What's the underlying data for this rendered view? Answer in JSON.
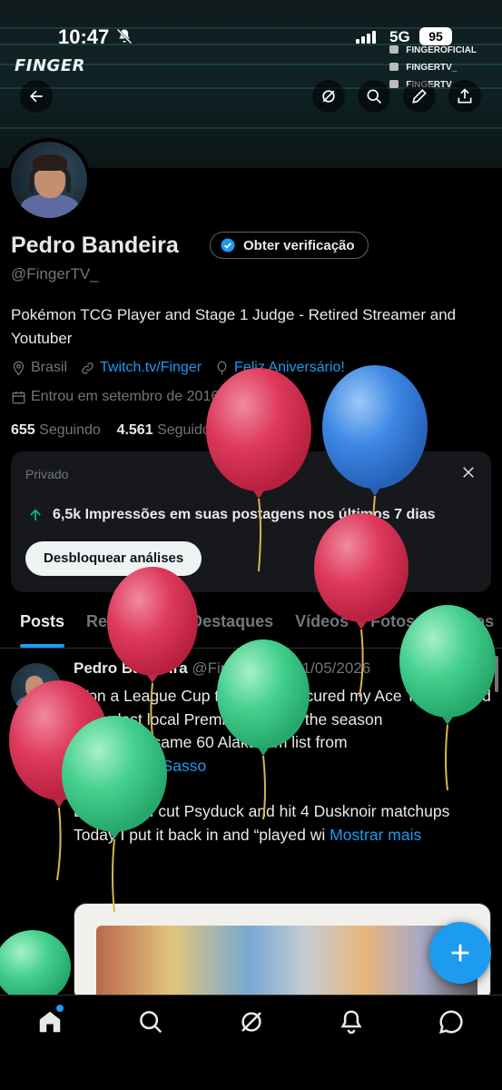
{
  "status_bar": {
    "time": "10:47",
    "network": "5G",
    "battery": "95"
  },
  "banner": {
    "logo": "FINGER",
    "social": [
      "FINGEROFICIAL",
      "FINGERTV_",
      "FINGERTV"
    ]
  },
  "profile": {
    "name": "Pedro Bandeira",
    "verify_label": "Obter verificação",
    "handle": "@FingerTV_",
    "bio": "Pokémon TCG Player and Stage 1 Judge - Retired Streamer and Youtuber",
    "location": "Brasil",
    "website": "Twitch.tv/Finger",
    "birthday": "Feliz Aniversário!",
    "joined": "Entrou em setembro de 2016",
    "following_count": "655",
    "following_label": "Seguindo",
    "followers_count": "4.561",
    "followers_label": "Seguidores"
  },
  "private_card": {
    "title": "Privado",
    "stat": "6,5k Impressões em suas postagens nos últimos 7 dias",
    "button": "Desbloquear análises"
  },
  "tabs": [
    "Posts",
    "Respostas",
    "Destaques",
    "Vídeos",
    "Fotos",
    "Artigos"
  ],
  "post": {
    "name": "Pedro Bandeira",
    "handle": "@FingerTV_",
    "date": "· 31/05/2026",
    "line1": "Won a League Cup today and secured my Ace Trainer card at the last local Premier event of the season",
    "line2_prefix": "Played the same 60  Alakazam list from",
    "mention": "@giovanny_Sasso",
    "line3": "Last week I cut Psyduck and hit 4 Dusknoir matchups",
    "line4": "Today I put it back in and “played wi",
    "more": "Mostrar mais"
  },
  "icons": {
    "back": "back-arrow-icon",
    "grok": "grok-icon",
    "search": "search-icon",
    "edit": "edit-icon",
    "share": "share-icon"
  },
  "colors": {
    "accent": "#1d9bf0",
    "balloon_red": "#e0375a",
    "balloon_blue": "#3a86e6",
    "balloon_green": "#3ccf8a"
  }
}
